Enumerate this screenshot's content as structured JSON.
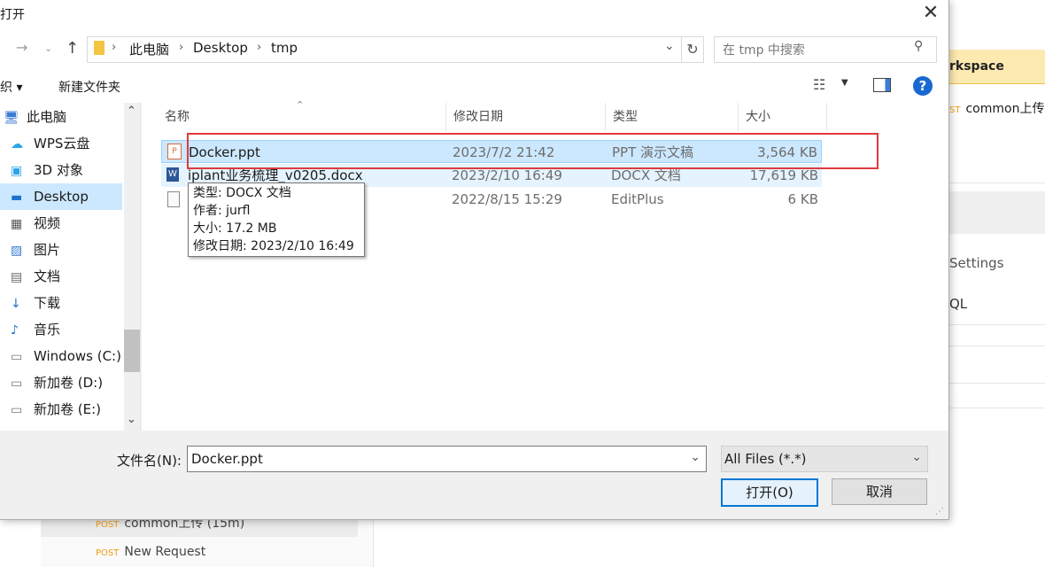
{
  "background_app": {
    "workspace_label": "rkspace",
    "items": [
      {
        "method": "ST",
        "label": "common上传"
      },
      {
        "method": "",
        "label": "Settings"
      },
      {
        "method": "",
        "label": "QL"
      }
    ],
    "left_items": [
      {
        "method": "POST",
        "label": "common上传 (15m)"
      },
      {
        "method": "POST",
        "label": "New Request"
      }
    ]
  },
  "dialog": {
    "title": "打开",
    "close_icon": "close-icon",
    "breadcrumb": [
      "此电脑",
      "Desktop",
      "tmp"
    ],
    "search_placeholder": "在 tmp 中搜索",
    "toolbar": {
      "organize": "织",
      "new_folder": "新建文件夹"
    },
    "nav_items": [
      {
        "label": "此电脑",
        "icon": "computer-icon"
      },
      {
        "label": "WPS云盘",
        "icon": "cloud-icon"
      },
      {
        "label": "3D 对象",
        "icon": "cube-icon"
      },
      {
        "label": "Desktop",
        "icon": "desktop-icon"
      },
      {
        "label": "视频",
        "icon": "video-icon"
      },
      {
        "label": "图片",
        "icon": "picture-icon"
      },
      {
        "label": "文档",
        "icon": "document-icon"
      },
      {
        "label": "下载",
        "icon": "download-icon"
      },
      {
        "label": "音乐",
        "icon": "music-icon"
      },
      {
        "label": "Windows (C:)",
        "icon": "drive-icon"
      },
      {
        "label": "新加卷 (D:)",
        "icon": "drive-icon"
      },
      {
        "label": "新加卷 (E:)",
        "icon": "drive-icon"
      }
    ],
    "columns": [
      "名称",
      "修改日期",
      "类型",
      "大小"
    ],
    "files": [
      {
        "name": "Docker.ppt",
        "date": "2023/7/2 21:42",
        "type": "PPT 演示文稿",
        "size": "3,564 KB",
        "icon": "ppt-icon"
      },
      {
        "name": "iplant业务梳理_v0205.docx",
        "date": "2023/2/10 16:49",
        "type": "DOCX 文档",
        "size": "17,619 KB",
        "icon": "word-icon"
      },
      {
        "name": "",
        "date": "2022/8/15 15:29",
        "type": "EditPlus",
        "size": "6 KB",
        "icon": "text-file-icon"
      }
    ],
    "tooltip": [
      "类型: DOCX 文档",
      "作者: jurfl",
      "大小: 17.2 MB",
      "修改日期: 2023/2/10 16:49"
    ],
    "filename_label": "文件名(N):",
    "filename_value": "Docker.ppt",
    "filter_value": "All Files (*.*)",
    "open_button": "打开(O)",
    "cancel_button": "取消",
    "accent": "#0078d7",
    "highlight_color": "#e0393e"
  }
}
